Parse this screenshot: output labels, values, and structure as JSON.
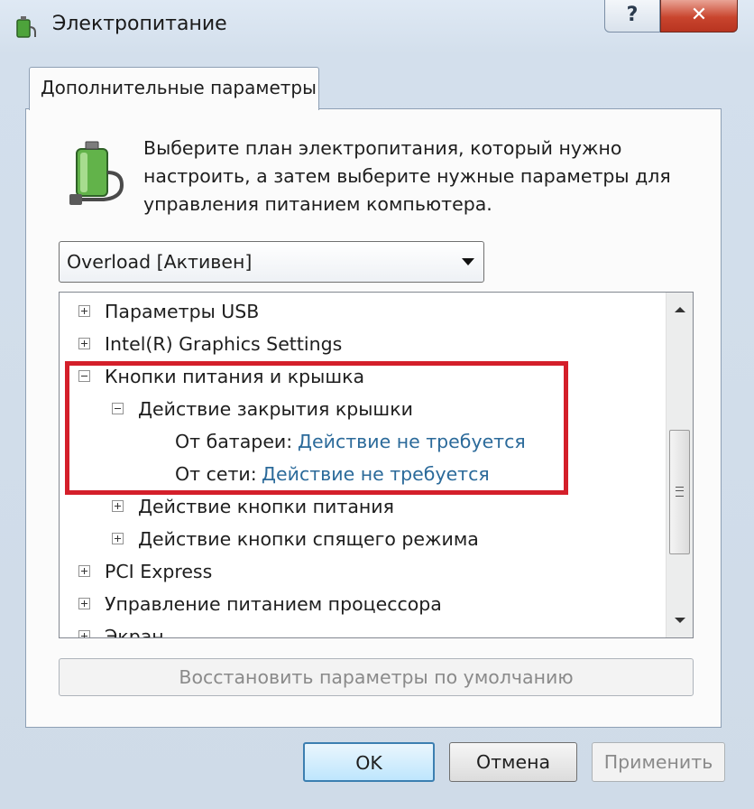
{
  "window": {
    "title": "Электропитание",
    "help_label": "?",
    "close_label": "✕"
  },
  "tab": {
    "label": "Дополнительные параметры"
  },
  "description": "Выберите план электропитания, который нужно настроить, а затем выберите нужные параметры для управления питанием компьютера.",
  "plan_select": {
    "value": "Overload [Активен]"
  },
  "tree": {
    "items": [
      {
        "label": "Параметры USB",
        "expander": "plus",
        "level": 0
      },
      {
        "label": "Intel(R) Graphics Settings",
        "expander": "plus",
        "level": 0
      },
      {
        "label": "Кнопки питания и крышка",
        "expander": "minus",
        "level": 0
      },
      {
        "label": "Действие закрытия крышки",
        "expander": "minus",
        "level": 1
      },
      {
        "label": "От батареи:",
        "value": "Действие не требуется",
        "level": 2
      },
      {
        "label": "От сети:",
        "value": "Действие не требуется",
        "level": 2
      },
      {
        "label": "Действие кнопки питания",
        "expander": "plus",
        "level": 1
      },
      {
        "label": "Действие кнопки спящего режима",
        "expander": "plus",
        "level": 1
      },
      {
        "label": "PCI Express",
        "expander": "plus",
        "level": 0
      },
      {
        "label": "Управление питанием процессора",
        "expander": "plus",
        "level": 0
      },
      {
        "label": "Экран",
        "expander": "plus",
        "level": 0
      }
    ]
  },
  "buttons": {
    "restore": "Восстановить параметры по умолчанию",
    "ok": "OK",
    "cancel": "Отмена",
    "apply": "Применить"
  },
  "colors": {
    "highlight": "#d41f2a",
    "link": "#2b6a9a"
  }
}
